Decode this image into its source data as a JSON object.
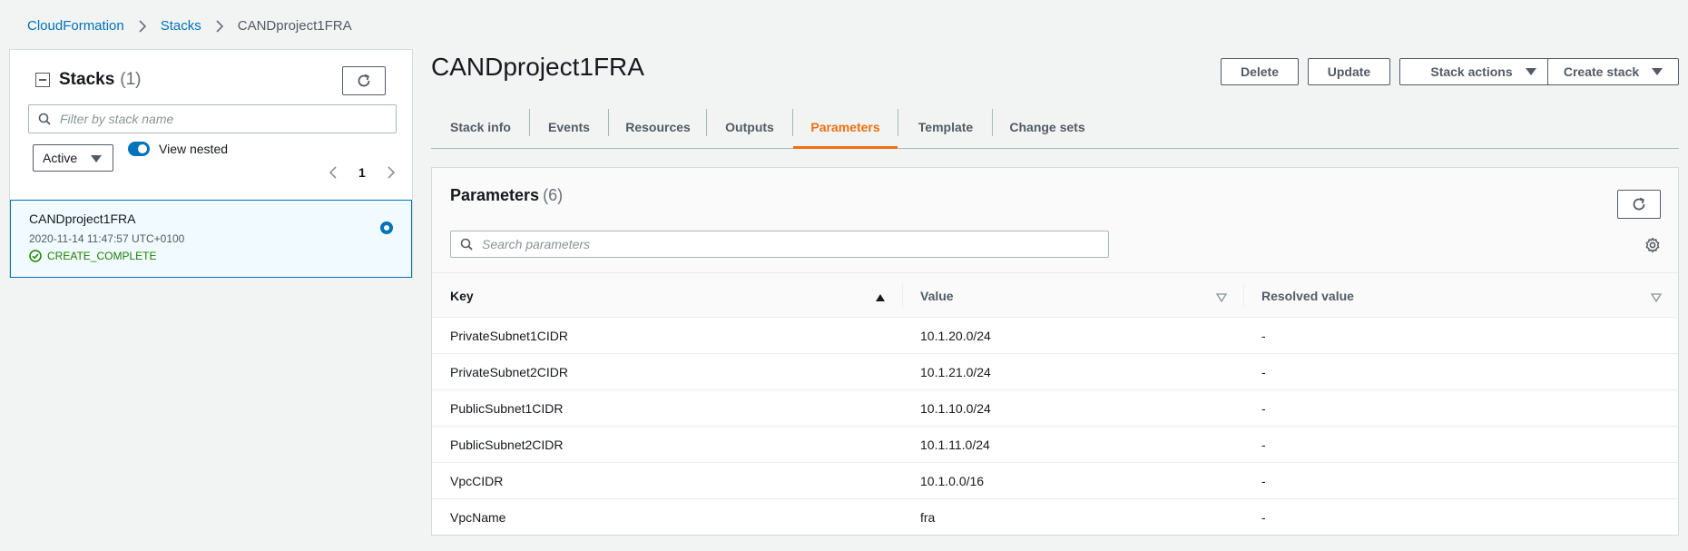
{
  "breadcrumb": [
    "CloudFormation",
    "Stacks",
    "CANDproject1FRA"
  ],
  "stacks_panel": {
    "title": "Stacks",
    "count": "(1)",
    "filter_placeholder": "Filter by stack name",
    "status_filter": "Active",
    "view_nested_label": "View nested",
    "view_nested_on": true,
    "page": "1",
    "items": [
      {
        "name": "CANDproject1FRA",
        "date": "2020-11-14 11:47:57 UTC+0100",
        "status": "CREATE_COMPLETE",
        "selected": true
      }
    ]
  },
  "main": {
    "title": "CANDproject1FRA",
    "buttons": {
      "delete": "Delete",
      "update": "Update",
      "stack_actions": "Stack actions",
      "create_stack": "Create stack"
    },
    "tabs": [
      "Stack info",
      "Events",
      "Resources",
      "Outputs",
      "Parameters",
      "Template",
      "Change sets"
    ],
    "active_tab": "Parameters"
  },
  "parameters": {
    "title": "Parameters",
    "count": "(6)",
    "search_placeholder": "Search parameters",
    "columns": {
      "key": "Key",
      "value": "Value",
      "resolved": "Resolved value"
    },
    "rows": [
      {
        "key": "PrivateSubnet1CIDR",
        "value": "10.1.20.0/24",
        "resolved": "-"
      },
      {
        "key": "PrivateSubnet2CIDR",
        "value": "10.1.21.0/24",
        "resolved": "-"
      },
      {
        "key": "PublicSubnet1CIDR",
        "value": "10.1.10.0/24",
        "resolved": "-"
      },
      {
        "key": "PublicSubnet2CIDR",
        "value": "10.1.11.0/24",
        "resolved": "-"
      },
      {
        "key": "VpcCIDR",
        "value": "10.1.0.0/16",
        "resolved": "-"
      },
      {
        "key": "VpcName",
        "value": "fra",
        "resolved": "-"
      }
    ]
  },
  "colors": {
    "link": "#0073bb",
    "accent": "#ec7211",
    "success": "#1d8102",
    "selected_bg": "#f1faff"
  }
}
